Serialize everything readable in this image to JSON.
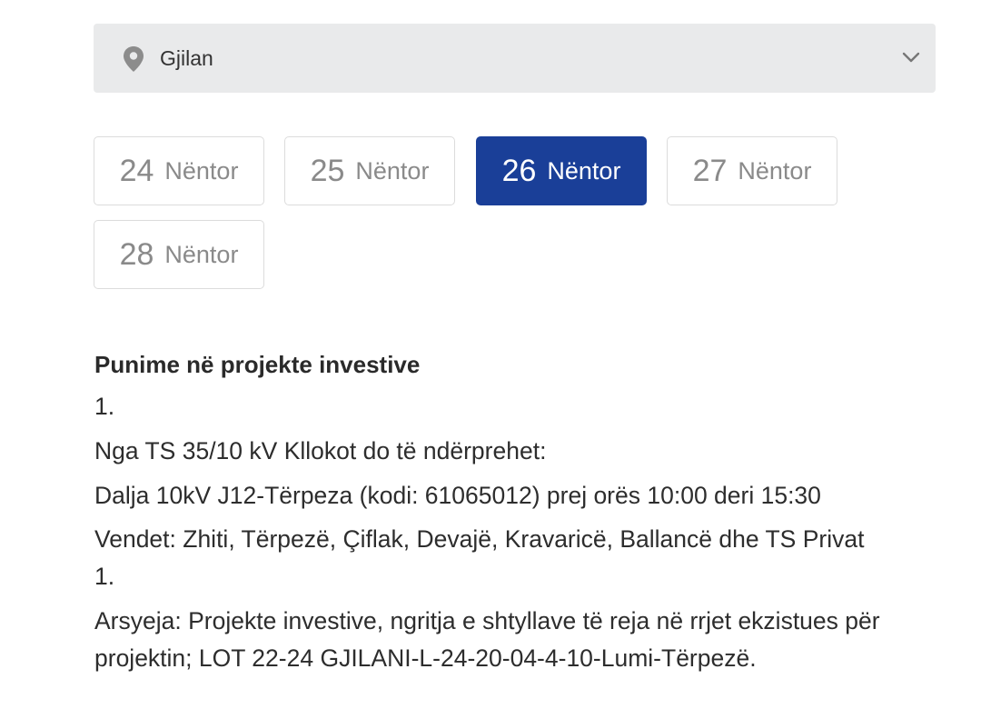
{
  "city_select": {
    "value": "Gjilan",
    "icon": "location-pin-icon",
    "chevron_icon": "chevron-down-icon"
  },
  "dates": [
    {
      "day": "24",
      "month": "Nëntor",
      "active": false
    },
    {
      "day": "25",
      "month": "Nëntor",
      "active": false
    },
    {
      "day": "26",
      "month": "Nëntor",
      "active": true
    },
    {
      "day": "27",
      "month": "Nëntor",
      "active": false
    },
    {
      "day": "28",
      "month": "Nëntor",
      "active": false
    }
  ],
  "colors": {
    "active_date_bg": "#1a3f98",
    "select_bg": "#e9eaeb",
    "inactive_text": "#8a8a8a"
  },
  "notice": {
    "heading": "Punime në projekte investive",
    "number_1": "1.",
    "source": "Nga TS 35/10 kV Kllokot do të ndërprehet:",
    "feeder": "Dalja 10kV J12-Tërpeza (kodi: 61065012) prej orës 10:00 deri 15:30",
    "places": "Vendet: Zhiti, Tërpezë, Çiflak, Devajë, Kravaricë, Ballancë dhe TS Privat",
    "number_2": "1.",
    "reason": "Arsyeja: Projekte investive, ngritja e shtyllave të reja në rrjet ekzistues për projektin; LOT 22-24 GJILANI-L-24-20-04-4-10-Lumi-Tërpezë."
  }
}
